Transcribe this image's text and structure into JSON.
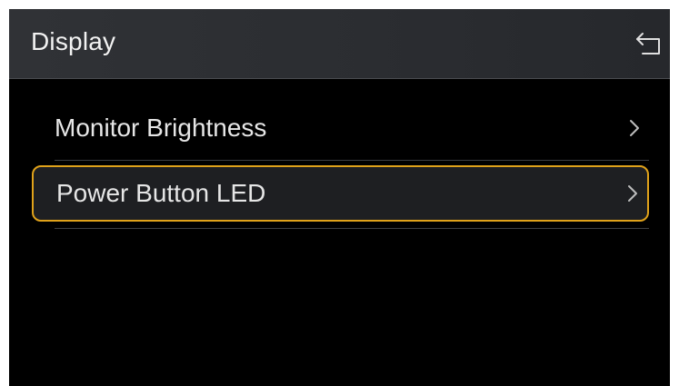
{
  "header": {
    "title": "Display",
    "back_icon": "return-arrow-icon"
  },
  "menu": {
    "items": [
      {
        "label": "Monitor Brightness",
        "icon": "chevron-right-icon",
        "selected": false
      },
      {
        "label": "Power Button LED",
        "icon": "chevron-right-icon",
        "selected": true
      }
    ]
  },
  "colors": {
    "background": "#000000",
    "header": "#2d2f33",
    "text": "#e6e6e6",
    "selection_border": "#e0a21a",
    "icon": "#bdbdbd"
  }
}
